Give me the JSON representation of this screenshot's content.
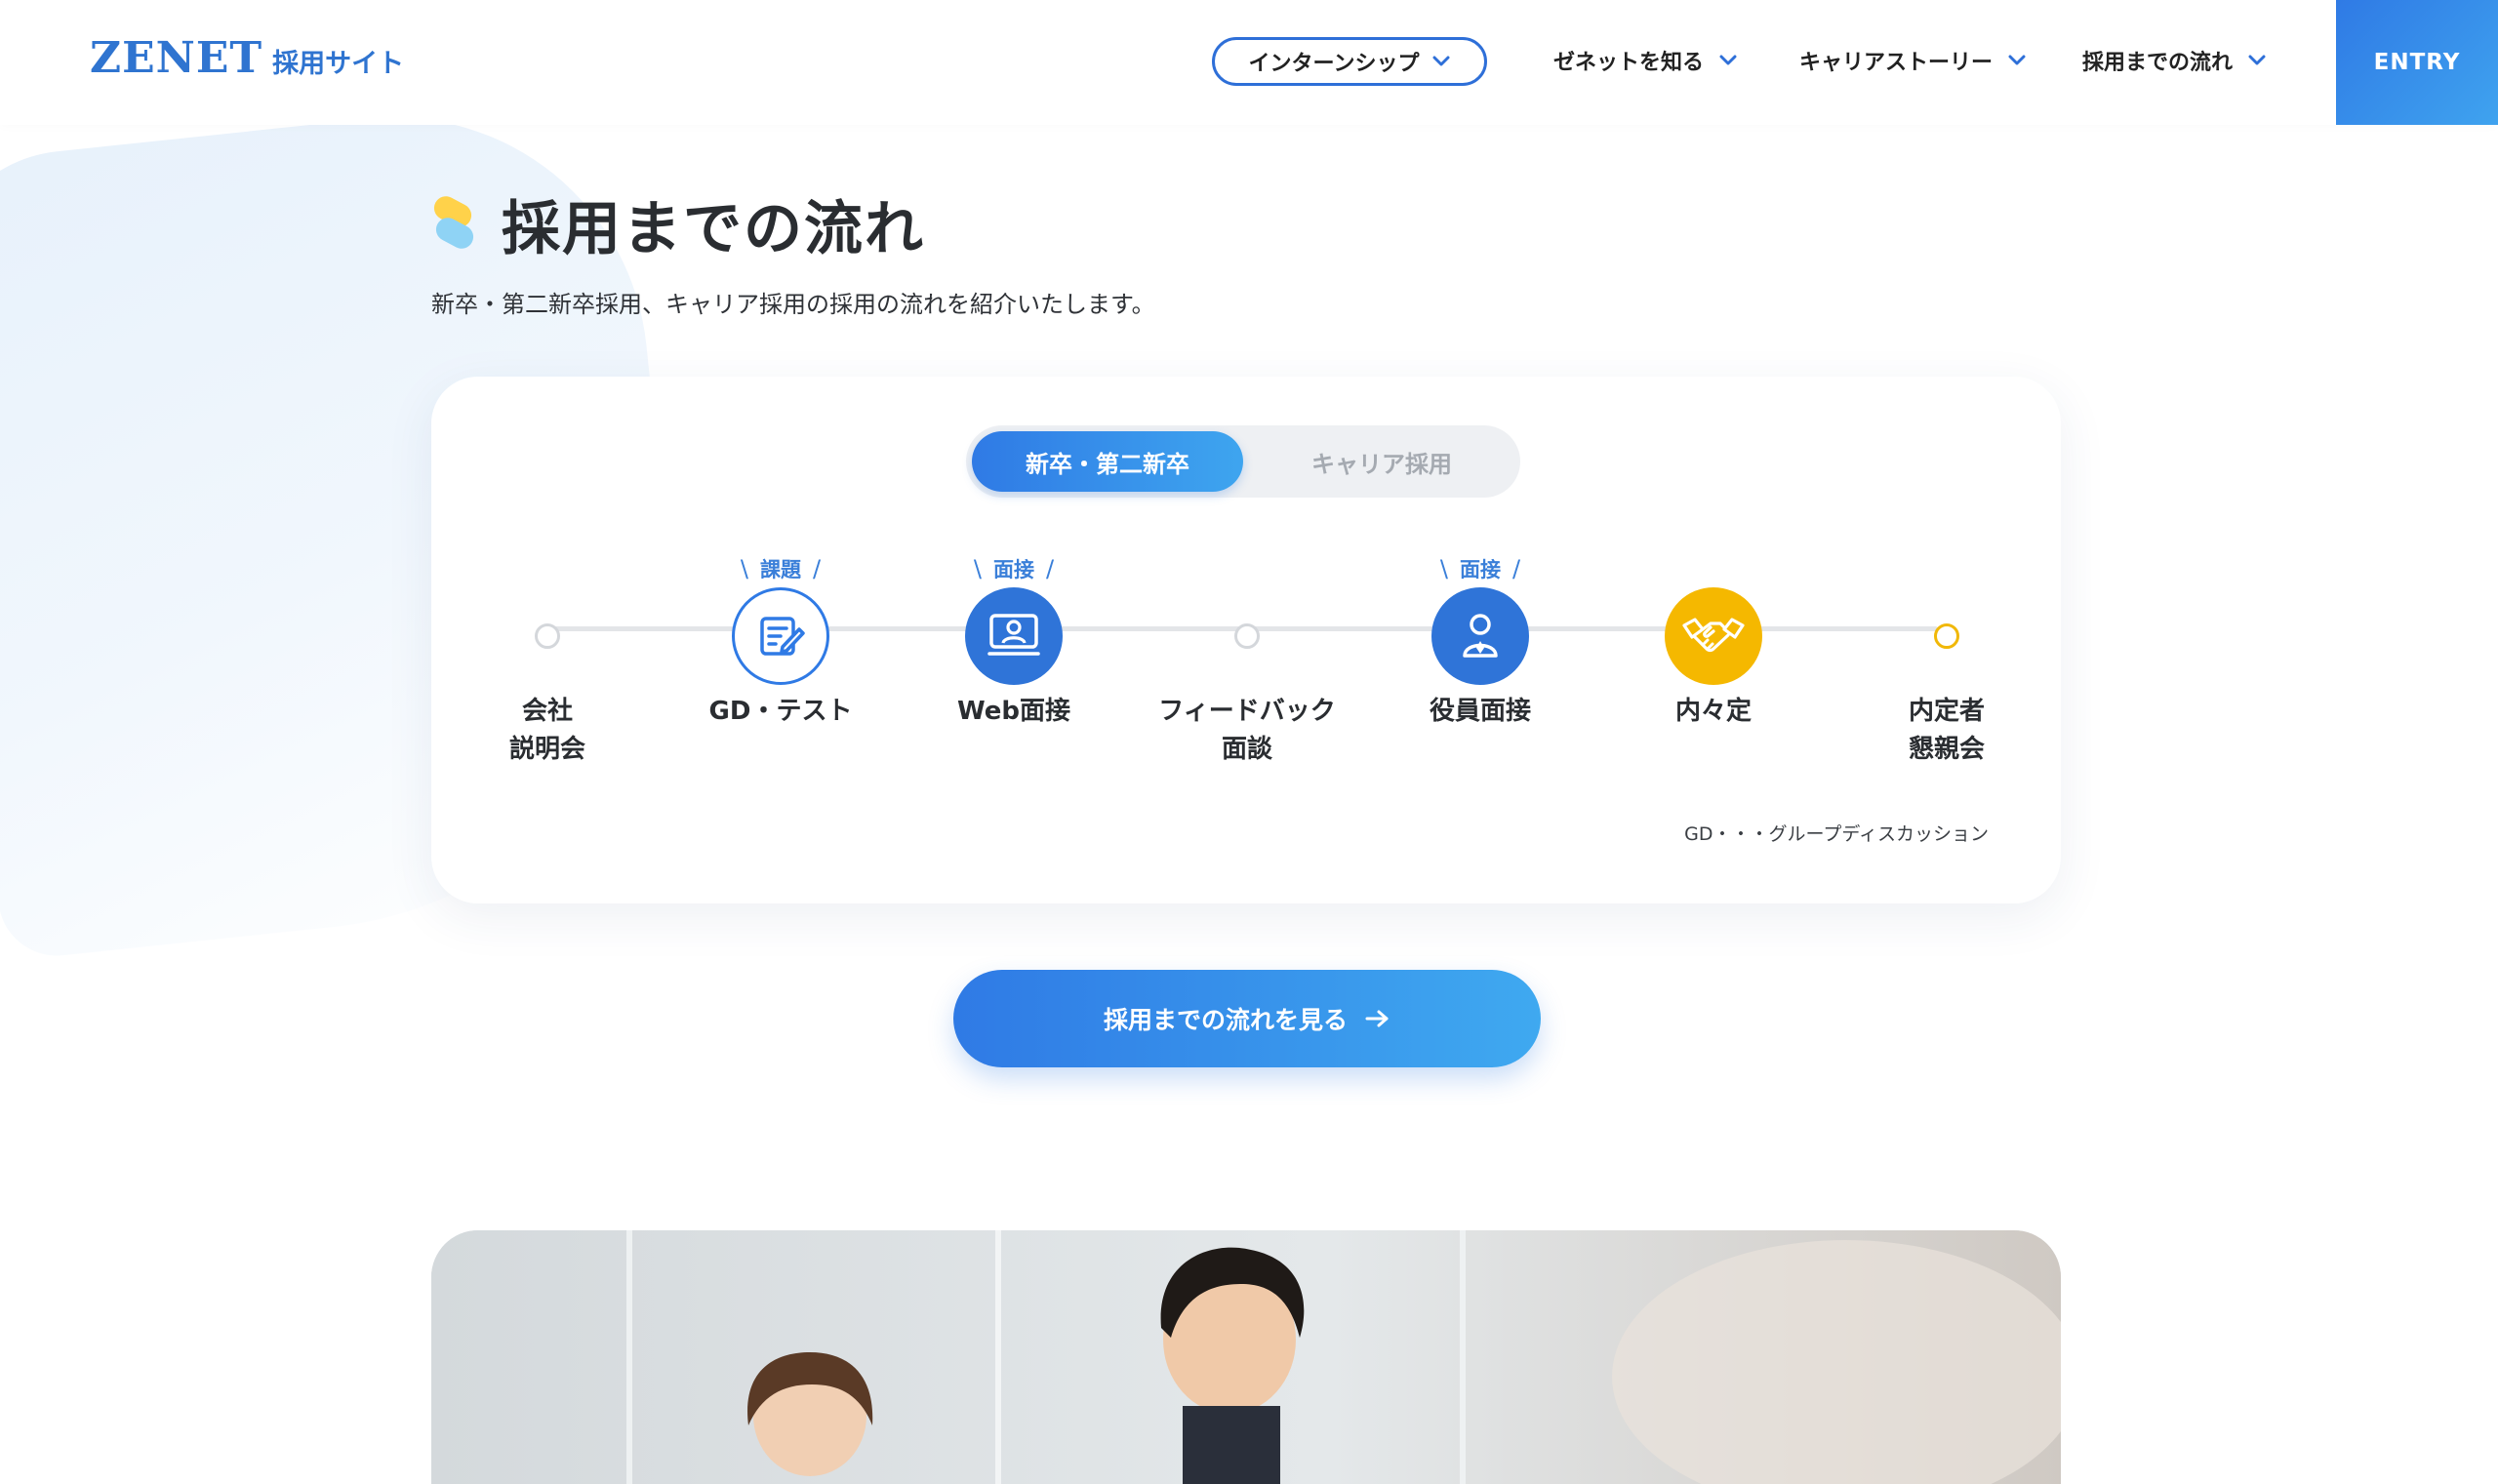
{
  "header": {
    "logo_main": "ZENET",
    "logo_sub": "採用サイト",
    "nav": {
      "internship": "インターンシップ",
      "about": "ゼネットを知る",
      "career_story": "キャリアストーリー",
      "flow": "採用までの流れ"
    },
    "entry": "ENTRY"
  },
  "section": {
    "title": "採用までの流れ",
    "lead": "新卒・第二新卒採用、キャリア採用の採用の流れを紹介いたします。"
  },
  "tabs": {
    "active": "新卒・第二新卒",
    "inactive": "キャリア採用"
  },
  "steps": [
    {
      "line1": "会社",
      "line2": "説明会",
      "badge": ""
    },
    {
      "line1": "GD・テスト",
      "line2": "",
      "badge": "課題"
    },
    {
      "line1": "Web面接",
      "line2": "",
      "badge": "面接"
    },
    {
      "line1": "フィードバック",
      "line2": "面談",
      "badge": ""
    },
    {
      "line1": "役員面接",
      "line2": "",
      "badge": "面接"
    },
    {
      "line1": "内々定",
      "line2": "",
      "badge": ""
    },
    {
      "line1": "内定者",
      "line2": "懇親会",
      "badge": ""
    }
  ],
  "note": "GD・・・グループディスカッション",
  "cta": "採用までの流れを見る",
  "colors": {
    "brand_blue": "#2f7ae5",
    "accent_yellow": "#f5b800"
  }
}
